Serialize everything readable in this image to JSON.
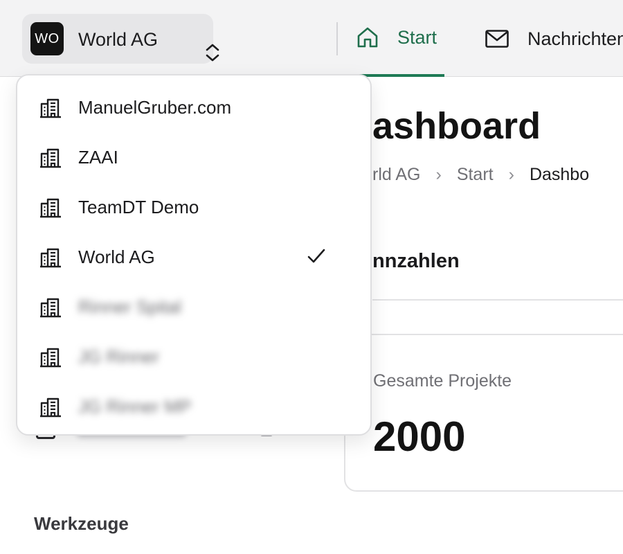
{
  "org_switcher": {
    "avatar_initials": "WO",
    "current_org": "World AG"
  },
  "nav": {
    "tabs": [
      {
        "label": "Start",
        "icon": "home-icon",
        "active": true
      },
      {
        "label": "Nachrichten",
        "icon": "mail-icon",
        "active": false
      }
    ]
  },
  "page": {
    "title": "ashboard",
    "breadcrumb": [
      "rld AG",
      "Start",
      "Dashbo"
    ],
    "section_title": "nnzahlen",
    "stat_card": {
      "label": "Gesamte Projekte",
      "value": "2000"
    }
  },
  "sidebar": {
    "tools_heading": "Werkzeuge"
  },
  "dropdown": {
    "items": [
      {
        "label": "ManuelGruber.com",
        "icon": "building-icon",
        "selected": false,
        "blurred": false
      },
      {
        "label": "ZAAI",
        "icon": "building-icon",
        "selected": false,
        "blurred": false
      },
      {
        "label": "TeamDT Demo",
        "icon": "building-icon",
        "selected": false,
        "blurred": false
      },
      {
        "label": "World AG",
        "icon": "building-icon",
        "selected": true,
        "blurred": false
      },
      {
        "label": "Rinner Spital",
        "icon": "building-icon",
        "selected": false,
        "blurred": true
      },
      {
        "label": "JG Rinner",
        "icon": "building-icon",
        "selected": false,
        "blurred": true
      },
      {
        "label": "JG Rinner MP",
        "icon": "building-icon",
        "selected": false,
        "blurred": true
      }
    ]
  },
  "colors": {
    "accent": "#1f7a55",
    "topbar_bg": "#f3f3f4",
    "switcher_bg": "#e6e6e8"
  }
}
